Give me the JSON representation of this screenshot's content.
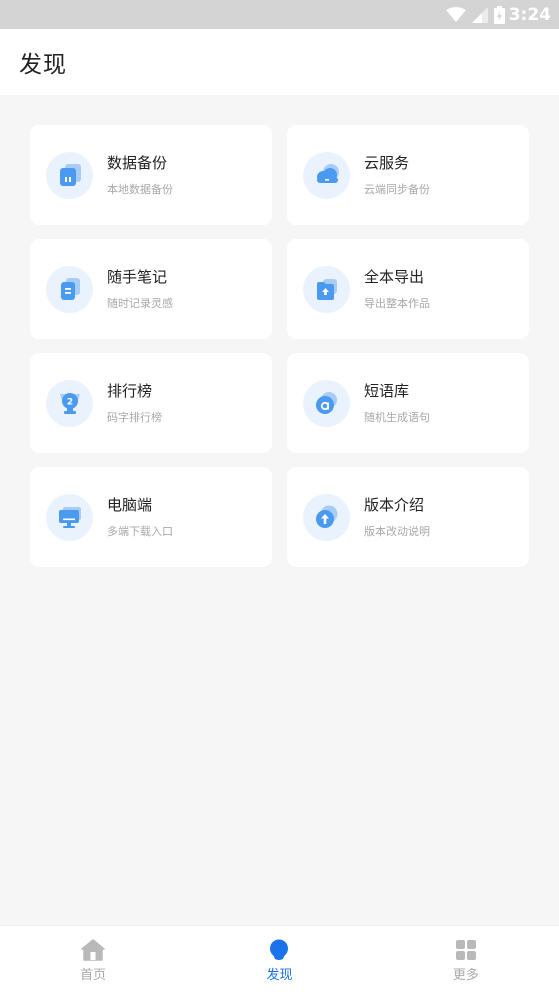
{
  "status_bar": {
    "time": "3:24",
    "icons": [
      "wifi-icon",
      "signal-icon",
      "battery-icon"
    ]
  },
  "header": {
    "title": "发现"
  },
  "features": [
    {
      "title": "数据备份",
      "subtitle": "本地数据备份",
      "icon": "database-backup-icon"
    },
    {
      "title": "云服务",
      "subtitle": "云端同步备份",
      "icon": "cloud-icon"
    },
    {
      "title": "随手笔记",
      "subtitle": "随时记录灵感",
      "icon": "note-icon"
    },
    {
      "title": "全本导出",
      "subtitle": "导出整本作品",
      "icon": "export-folder-icon"
    },
    {
      "title": "排行榜",
      "subtitle": "码字排行榜",
      "icon": "trophy-icon"
    },
    {
      "title": "短语库",
      "subtitle": "随机生成语句",
      "icon": "phrase-library-icon"
    },
    {
      "title": "电脑端",
      "subtitle": "多端下载入口",
      "icon": "desktop-icon"
    },
    {
      "title": "版本介绍",
      "subtitle": "版本改动说明",
      "icon": "version-upgrade-icon"
    }
  ],
  "bottom_nav": {
    "items": [
      {
        "label": "首页",
        "icon": "home-icon",
        "active": false
      },
      {
        "label": "发现",
        "icon": "discover-icon",
        "active": true
      },
      {
        "label": "更多",
        "icon": "grid-more-icon",
        "active": false
      }
    ]
  },
  "colors": {
    "accent": "#1a73e8",
    "icon_light": "#a7cdf7",
    "icon_main": "#4a9af2",
    "icon_bg": "#eaf3fd",
    "page_bg": "#f6f6f6",
    "inactive": "#a9a9a9"
  }
}
